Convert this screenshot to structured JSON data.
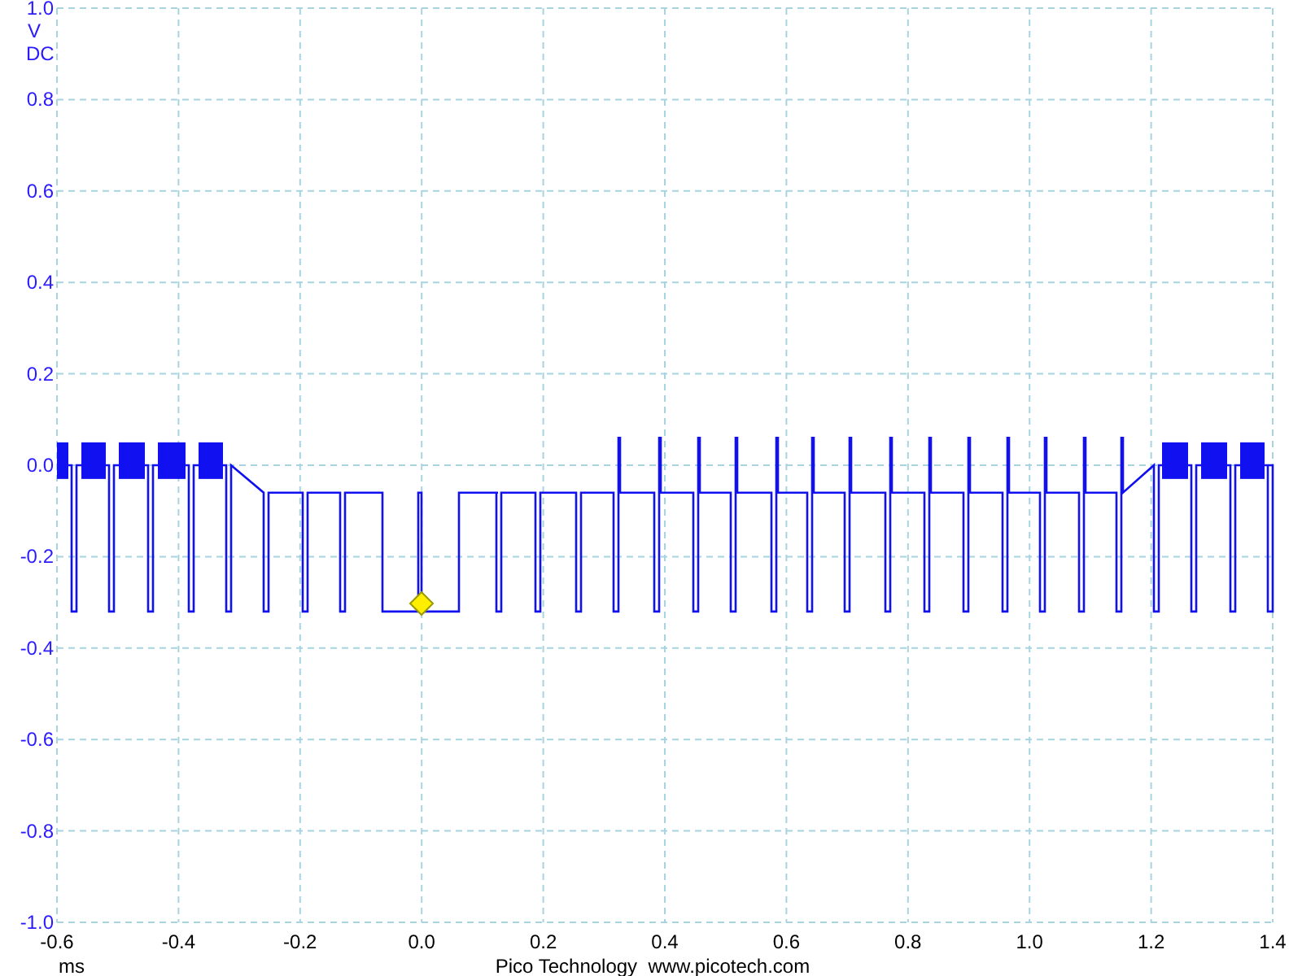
{
  "y_axis": {
    "ticks": [
      "1.0",
      "0.8",
      "0.6",
      "0.4",
      "0.2",
      "0.0",
      "-0.2",
      "-0.4",
      "-0.6",
      "-0.8",
      "-1.0"
    ],
    "unit": "V",
    "coupling": "DC"
  },
  "x_axis": {
    "ticks": [
      "-0.6",
      "-0.4",
      "-0.2",
      "0.0",
      "0.2",
      "0.4",
      "0.6",
      "0.8",
      "1.0",
      "1.2",
      "1.4"
    ],
    "unit": "ms"
  },
  "footer": "Pico Technology  www.picotech.com"
}
